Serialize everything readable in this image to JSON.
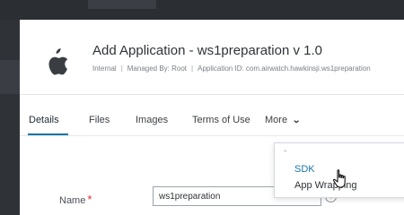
{
  "app": {
    "title": "Add Application - ws1preparation v 1.0",
    "meta": {
      "type": "Internal",
      "managed_by": "Managed By: Root",
      "app_id": "Application ID: com.airwatch.hawkinsji.ws1preparation"
    }
  },
  "tabs": [
    {
      "label": "Details",
      "active": true
    },
    {
      "label": "Files",
      "active": false
    },
    {
      "label": "Images",
      "active": false
    },
    {
      "label": "Terms of Use",
      "active": false
    },
    {
      "label": "More",
      "active": false
    }
  ],
  "more_menu": {
    "expanded": true,
    "items": [
      "SDK",
      "App Wrapping"
    ]
  },
  "form": {
    "name_label": "Name",
    "required_mark": "*",
    "name_value": "ws1preparation"
  },
  "icons": {
    "app": "apple-logo-icon",
    "more_toggle": "chevron-down-icon",
    "help": "info-icon",
    "pointer": "hand-cursor-icon"
  },
  "colors": {
    "accent": "#1a73a8",
    "required": "#e0262b",
    "chrome": "#2e3136"
  }
}
